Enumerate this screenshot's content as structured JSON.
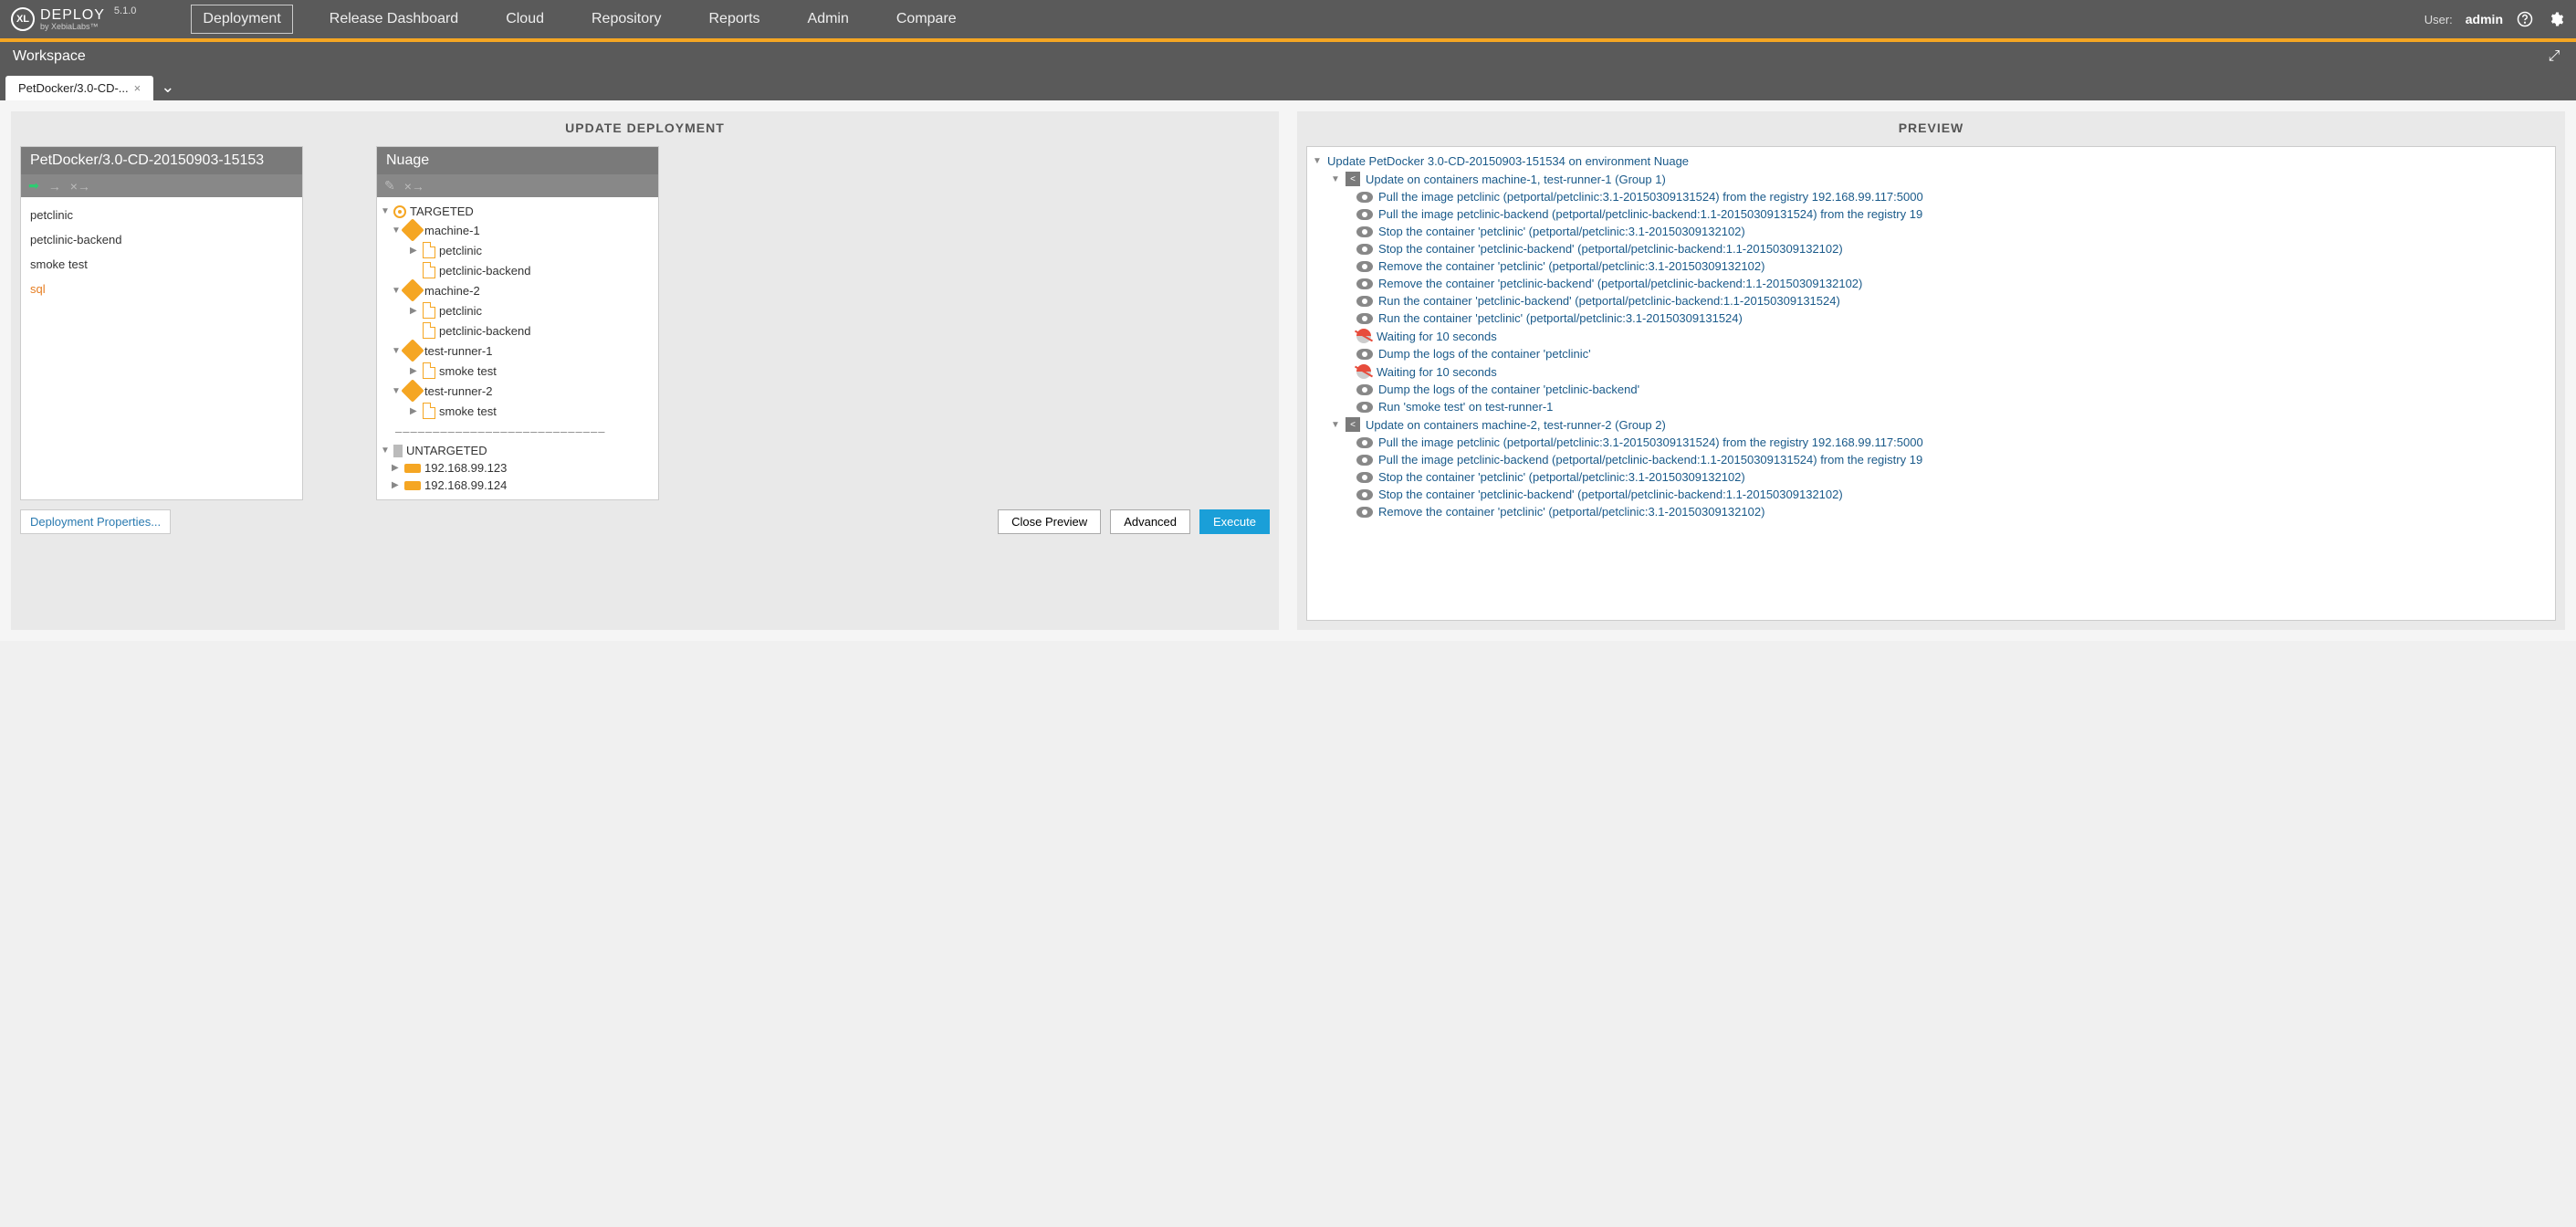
{
  "header": {
    "product": "DEPLOY",
    "vendor": "by XebiaLabs™",
    "version": "5.1.0",
    "nav": [
      "Deployment",
      "Release Dashboard",
      "Cloud",
      "Repository",
      "Reports",
      "Admin",
      "Compare"
    ],
    "user_label": "User:",
    "user_name": "admin"
  },
  "workspace": {
    "title": "Workspace",
    "tab": "PetDocker/3.0-CD-..."
  },
  "left_panel": {
    "title": "UPDATE DEPLOYMENT",
    "package_header": "PetDocker/3.0-CD-20150903-15153",
    "package_items": [
      "petclinic",
      "petclinic-backend",
      "smoke test",
      "sql"
    ],
    "env_header": "Nuage",
    "targeted_label": "TARGETED",
    "untargeted_label": "UNTARGETED",
    "machines": [
      {
        "name": "machine-1",
        "items": [
          "petclinic",
          "petclinic-backend"
        ]
      },
      {
        "name": "machine-2",
        "items": [
          "petclinic",
          "petclinic-backend"
        ]
      },
      {
        "name": "test-runner-1",
        "items": [
          "smoke test"
        ]
      },
      {
        "name": "test-runner-2",
        "items": [
          "smoke test"
        ]
      }
    ],
    "untargeted_hosts": [
      "192.168.99.123",
      "192.168.99.124"
    ],
    "buttons": {
      "props": "Deployment Properties...",
      "close": "Close Preview",
      "advanced": "Advanced",
      "execute": "Execute"
    }
  },
  "preview": {
    "title": "PREVIEW",
    "root": "Update PetDocker 3.0-CD-20150903-151534 on environment Nuage",
    "group1": "Update on containers machine-1, test-runner-1 (Group 1)",
    "group2": "Update on containers machine-2, test-runner-2 (Group 2)",
    "g1_steps": [
      "Pull the image petclinic (petportal/petclinic:3.1-20150309131524) from the registry 192.168.99.117:5000",
      "Pull the image petclinic-backend (petportal/petclinic-backend:1.1-20150309131524) from the registry 19",
      "Stop the container 'petclinic' (petportal/petclinic:3.1-20150309132102)",
      "Stop the container 'petclinic-backend' (petportal/petclinic-backend:1.1-20150309132102)",
      "Remove the container 'petclinic' (petportal/petclinic:3.1-20150309132102)",
      "Remove the container 'petclinic-backend' (petportal/petclinic-backend:1.1-20150309132102)",
      "Run the container 'petclinic-backend' (petportal/petclinic-backend:1.1-20150309131524)",
      "Run the container 'petclinic' (petportal/petclinic:3.1-20150309131524)",
      "Waiting for 10 seconds",
      "Dump the logs of the container 'petclinic'",
      "Waiting for 10 seconds",
      "Dump the logs of the container 'petclinic-backend'",
      "Run 'smoke test' on test-runner-1"
    ],
    "g2_steps": [
      "Pull the image petclinic (petportal/petclinic:3.1-20150309131524) from the registry 192.168.99.117:5000",
      "Pull the image petclinic-backend (petportal/petclinic-backend:1.1-20150309131524) from the registry 19",
      "Stop the container 'petclinic' (petportal/petclinic:3.1-20150309132102)",
      "Stop the container 'petclinic-backend' (petportal/petclinic-backend:1.1-20150309132102)",
      "Remove the container 'petclinic' (petportal/petclinic:3.1-20150309132102)"
    ],
    "wait_indices_g1": [
      8,
      10
    ]
  }
}
